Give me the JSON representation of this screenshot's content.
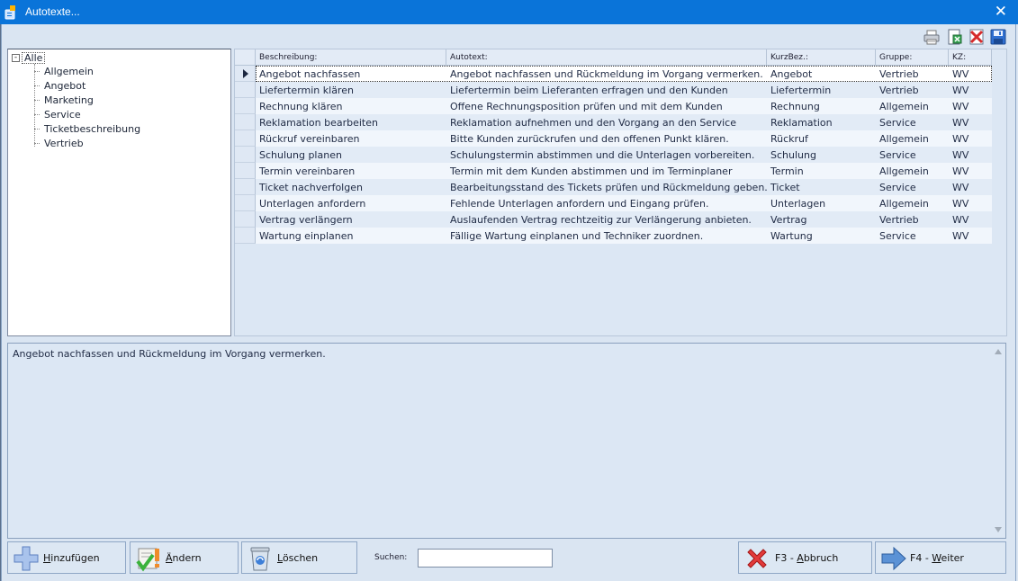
{
  "window": {
    "title": "Autotexte...",
    "close_glyph": "✕",
    "title_bar_color": "#0a74d9"
  },
  "toolbar_icons": [
    "print-icon",
    "export-icon",
    "delete-icon",
    "save-icon"
  ],
  "tree": {
    "expand_glyph": "-",
    "root": "Alle",
    "children": [
      "Allgemein",
      "Angebot",
      "Marketing",
      "Service",
      "Ticketbeschreibung",
      "Vertrieb"
    ]
  },
  "grid": {
    "columns": [
      "Beschreibung:",
      "Autotext:",
      "KurzBez.:",
      "Gruppe:",
      "KZ:"
    ],
    "selected_index": 0,
    "rows": [
      [
        "Angebot nachfassen",
        "Angebot nachfassen und Rückmeldung im Vorgang vermerken.",
        "Angebot",
        "Vertrieb",
        "WV"
      ],
      [
        "Liefertermin klären",
        "Liefertermin beim Lieferanten erfragen und den Kunden",
        "Liefertermin",
        "Vertrieb",
        "WV"
      ],
      [
        "Rechnung klären",
        "Offene Rechnungsposition prüfen und mit dem Kunden",
        "Rechnung",
        "Allgemein",
        "WV"
      ],
      [
        "Reklamation bearbeiten",
        "Reklamation aufnehmen und den Vorgang an den Service",
        "Reklamation",
        "Service",
        "WV"
      ],
      [
        "Rückruf vereinbaren",
        "Bitte Kunden zurückrufen und den offenen Punkt klären.",
        "Rückruf",
        "Allgemein",
        "WV"
      ],
      [
        "Schulung planen",
        "Schulungstermin abstimmen und die Unterlagen vorbereiten.",
        "Schulung",
        "Service",
        "WV"
      ],
      [
        "Termin vereinbaren",
        "Termin mit dem Kunden abstimmen und im Terminplaner",
        "Termin",
        "Allgemein",
        "WV"
      ],
      [
        "Ticket nachverfolgen",
        "Bearbeitungsstand des Tickets prüfen und Rückmeldung geben.",
        "Ticket",
        "Service",
        "WV"
      ],
      [
        "Unterlagen anfordern",
        "Fehlende Unterlagen anfordern und Eingang prüfen.",
        "Unterlagen",
        "Allgemein",
        "WV"
      ],
      [
        "Vertrag verlängern",
        "Auslaufenden Vertrag rechtzeitig zur Verlängerung anbieten.",
        "Vertrag",
        "Vertrieb",
        "WV"
      ],
      [
        "Wartung einplanen",
        "Fällige Wartung einplanen und Techniker zuordnen.",
        "Wartung",
        "Service",
        "WV"
      ]
    ]
  },
  "preview": {
    "text": "Angebot nachfassen und Rückmeldung im Vorgang vermerken."
  },
  "buttons": {
    "add": {
      "accel": "H",
      "rest": "inzufügen"
    },
    "edit": {
      "accel": "Ä",
      "rest": "ndern"
    },
    "delete": {
      "accel": "L",
      "rest": "öschen"
    },
    "cancel": {
      "prefix": "F3 - ",
      "accel": "A",
      "rest": "bbruch"
    },
    "next": {
      "prefix": "F4 - ",
      "accel": "W",
      "rest": "eiter"
    }
  },
  "search": {
    "label": "Suchen:",
    "value": ""
  }
}
